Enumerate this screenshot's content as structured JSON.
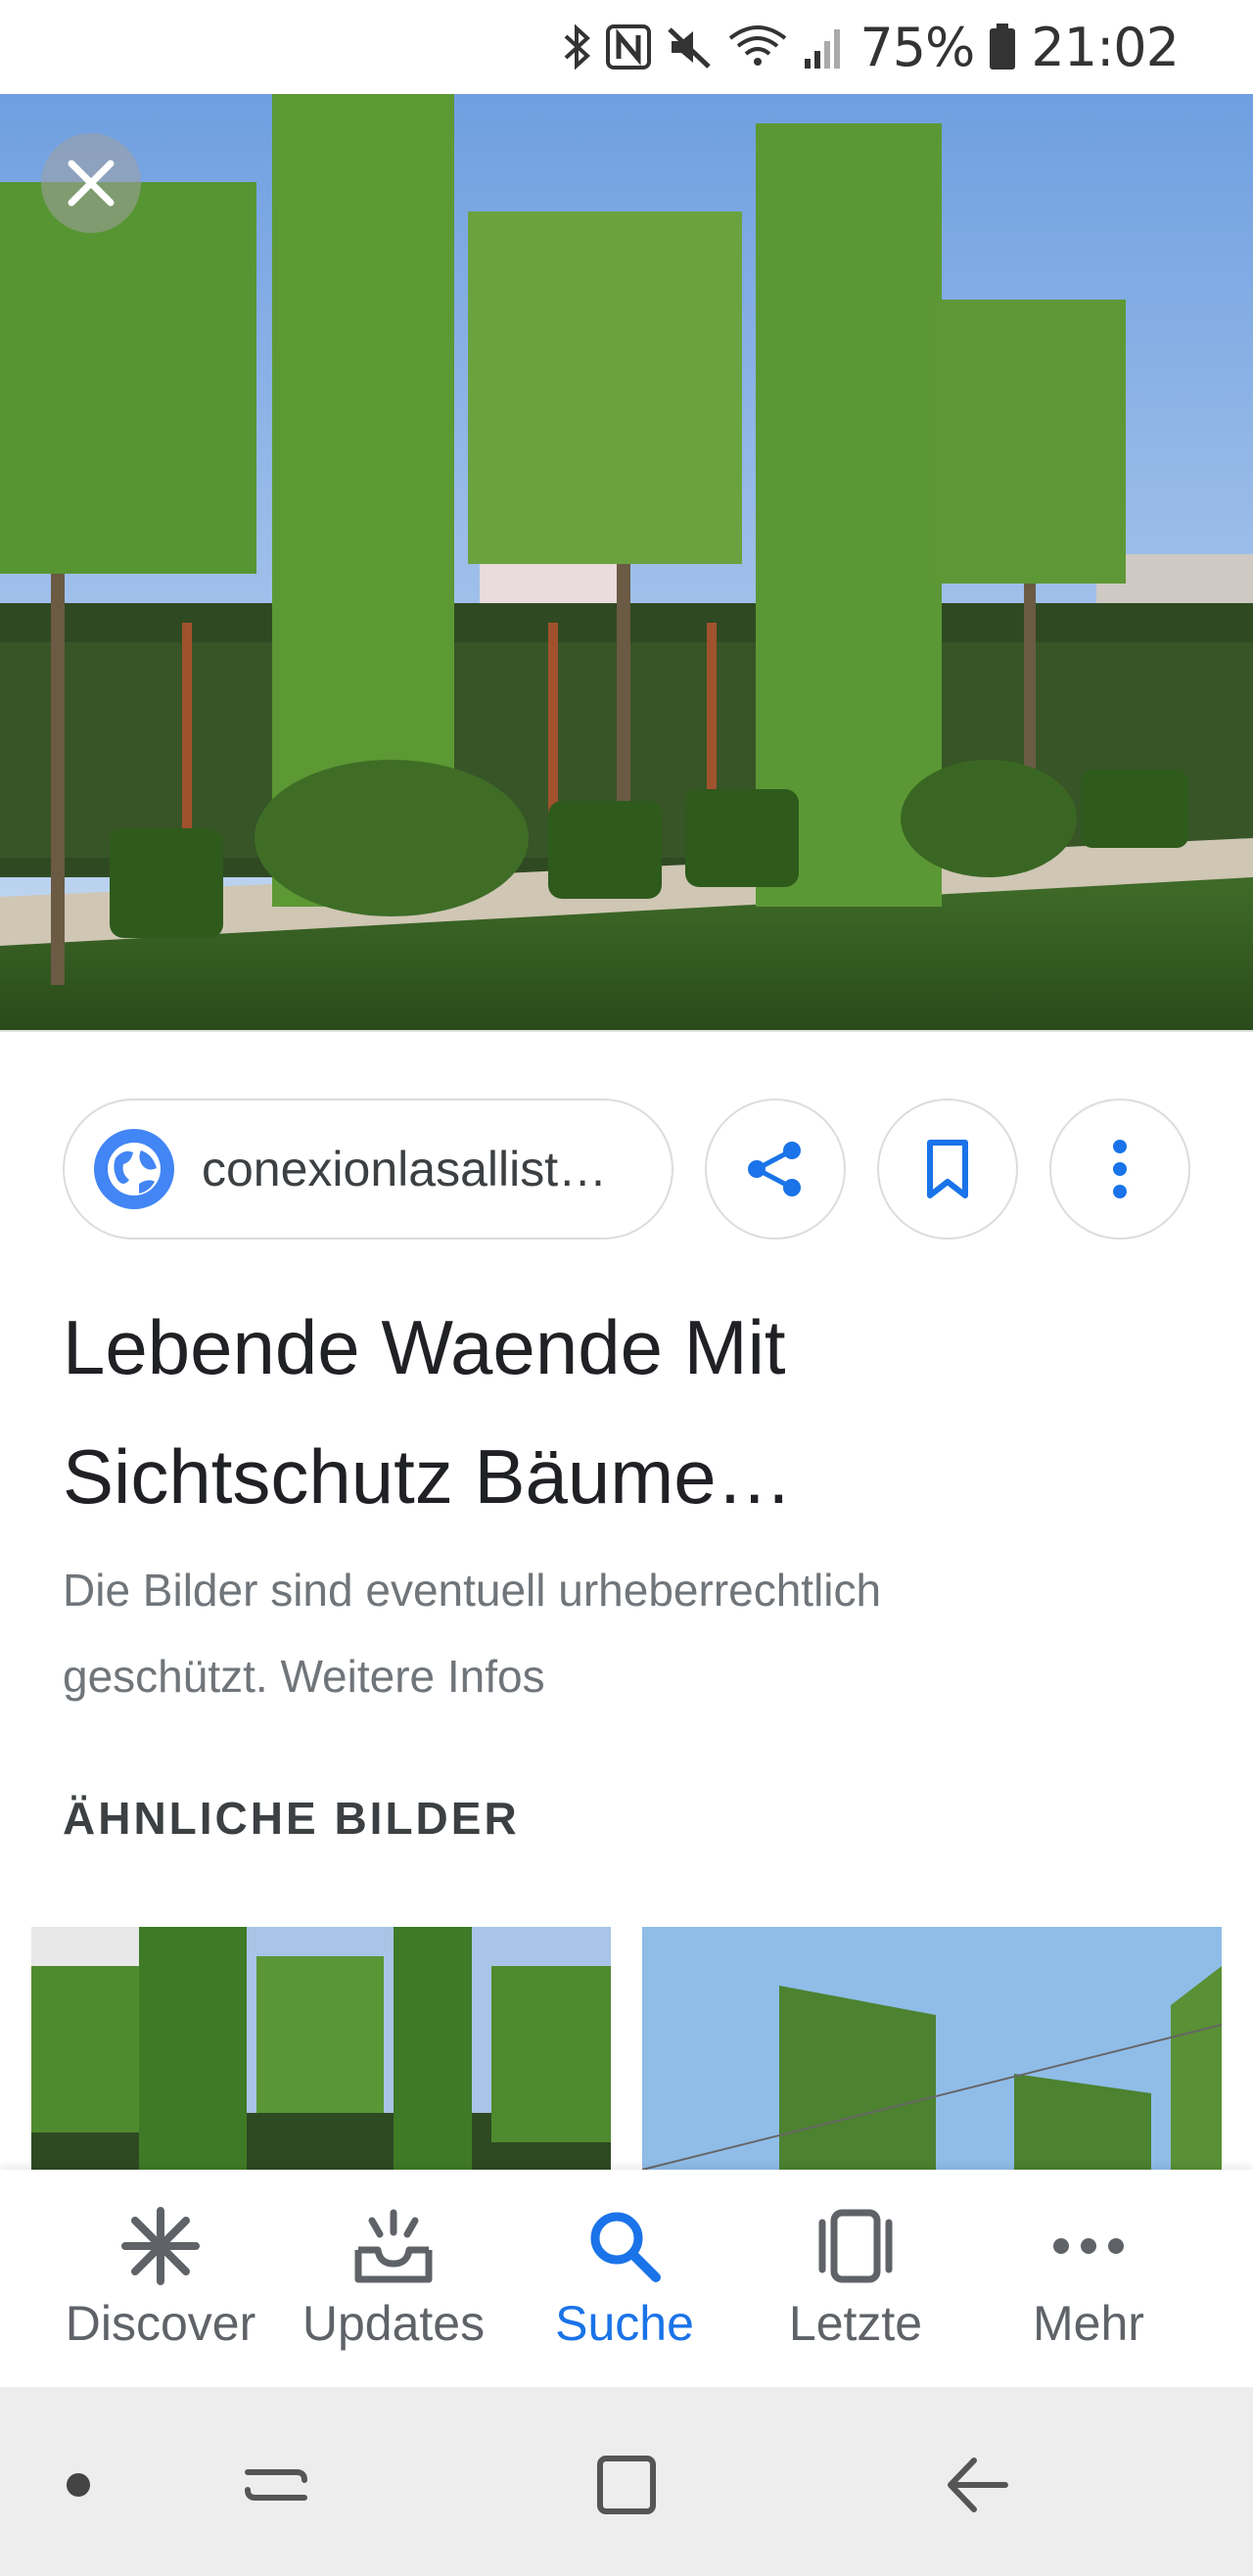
{
  "status_bar": {
    "battery": "75%",
    "time": "21:02",
    "icons": [
      "bluetooth-icon",
      "nfc-icon",
      "mute-icon",
      "wifi-icon",
      "signal-icon",
      "battery-icon"
    ]
  },
  "source": {
    "domain": "conexionlasallist…"
  },
  "result": {
    "title_line1": "Lebende Waende Mit",
    "title_line2": "Sichtschutz Bäume…",
    "notice_line1": "Die Bilder sind eventuell urheberrechtlich",
    "notice_line2": "geschützt. Weitere Infos"
  },
  "similar": {
    "heading": "ÄHNLICHE BILDER"
  },
  "bottom_nav": {
    "items": [
      {
        "label": "Discover",
        "icon": "asterisk-icon"
      },
      {
        "label": "Updates",
        "icon": "inbox-icon"
      },
      {
        "label": "Suche",
        "icon": "search-icon"
      },
      {
        "label": "Letzte",
        "icon": "recent-cards-icon"
      },
      {
        "label": "Mehr",
        "icon": "more-horizontal-icon"
      }
    ],
    "active": "Suche"
  },
  "colors": {
    "accent": "#1a73e8",
    "text_primary": "#202124",
    "text_secondary": "#70757a",
    "border": "#dadce0"
  }
}
